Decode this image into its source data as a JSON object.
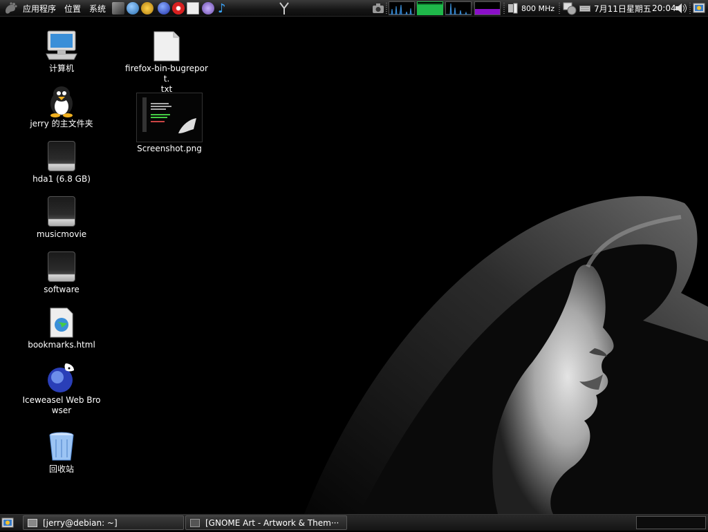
{
  "top_panel": {
    "menus": {
      "applications": "应用程序",
      "places": "位置",
      "system": "系统"
    },
    "launchers": [
      "screwdriver-tool-icon",
      "globe-browser-icon",
      "mail-icon",
      "firefox-icon",
      "opera-icon",
      "text-editor-icon",
      "pidgin-icon",
      "music-note-icon"
    ],
    "cpu_freq": "800 MHz",
    "clock": {
      "date": "7月11日星期五",
      "time": "20:04"
    }
  },
  "desktop": {
    "icons": [
      {
        "label": "计算机",
        "icon": "computer-icon"
      },
      {
        "label": "jerry 的主文件夹",
        "icon": "home-folder-icon"
      },
      {
        "label": "hda1 (6.8 GB)",
        "icon": "hard-drive-icon"
      },
      {
        "label": "musicmovie",
        "icon": "hard-drive-icon"
      },
      {
        "label": "software",
        "icon": "hard-drive-icon"
      },
      {
        "label": "bookmarks.html",
        "icon": "html-file-icon"
      },
      {
        "label": "Iceweasel Web Browser",
        "icon": "iceweasel-icon"
      },
      {
        "label": "回收站",
        "icon": "trash-icon"
      },
      {
        "label": "firefox-bin-bugreport.\ntxt",
        "icon": "text-file-icon"
      },
      {
        "label": "Screenshot.png",
        "icon": "image-thumbnail-icon"
      }
    ]
  },
  "taskbar": {
    "tasks": [
      {
        "label": "[jerry@debian: ~]",
        "icon": "terminal-icon"
      },
      {
        "label": "[GNOME Art - Artwork & Them···",
        "icon": "browser-icon"
      }
    ]
  },
  "colors": {
    "panel": "#1a1a1a",
    "desktop": "#000000",
    "graph_green": "#1fb84a",
    "graph_blue": "#3a8fd8",
    "graph_purple": "#8a10c8"
  }
}
